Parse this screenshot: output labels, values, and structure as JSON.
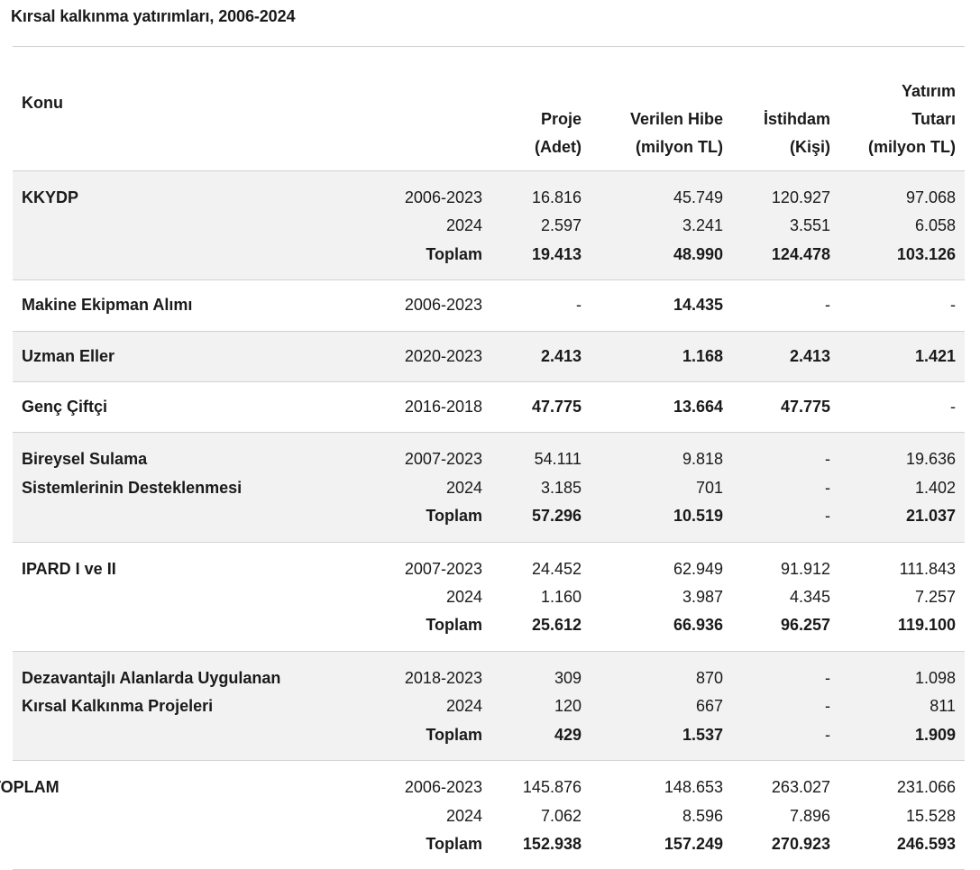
{
  "title": "Kırsal kalkınma yatırımları, 2006-2024",
  "headers": {
    "konu": "Konu",
    "proje_line1": "Proje",
    "proje_line2": "(Adet)",
    "hibe_line1": "Verilen Hibe",
    "hibe_line2": "(milyon TL)",
    "istihdam_line1": "İstihdam",
    "istihdam_line2": "(Kişi)",
    "yatirim_line1": "Yatırım",
    "yatirim_line2": "Tutarı",
    "yatirim_line3": "(milyon TL)"
  },
  "groups": [
    {
      "name_line1": "KKYDP",
      "rows": [
        [
          "2006-2023",
          "16.816",
          "45.749",
          "120.927",
          "97.068"
        ],
        [
          "2024",
          "2.597",
          "3.241",
          "3.551",
          "6.058"
        ],
        [
          "Toplam",
          "19.413",
          "48.990",
          "124.478",
          "103.126"
        ]
      ]
    },
    {
      "name_line1": "Makine Ekipman Alımı",
      "rows": [
        [
          "2006-2023",
          "-",
          "14.435",
          "-",
          "-"
        ]
      ]
    },
    {
      "name_line1": "Uzman Eller",
      "rows": [
        [
          "2020-2023",
          "2.413",
          "1.168",
          "2.413",
          "1.421"
        ]
      ]
    },
    {
      "name_line1": "Genç Çiftçi",
      "rows": [
        [
          "2016-2018",
          "47.775",
          "13.664",
          "47.775",
          "-"
        ]
      ]
    },
    {
      "name_line1": "Bireysel Sulama",
      "name_line2": "Sistemlerinin Desteklenmesi",
      "rows": [
        [
          "2007-2023",
          "54.111",
          "9.818",
          "-",
          "19.636"
        ],
        [
          "2024",
          "3.185",
          "701",
          "-",
          "1.402"
        ],
        [
          "Toplam",
          "57.296",
          "10.519",
          "-",
          "21.037"
        ]
      ]
    },
    {
      "name_line1": "IPARD I ve II",
      "rows": [
        [
          "2007-2023",
          "24.452",
          "62.949",
          "91.912",
          "111.843"
        ],
        [
          "2024",
          "1.160",
          "3.987",
          "4.345",
          "7.257"
        ],
        [
          "Toplam",
          "25.612",
          "66.936",
          "96.257",
          "119.100"
        ]
      ]
    },
    {
      "name_line1": "Dezavantajlı Alanlarda Uygulanan",
      "name_line2": "Kırsal Kalkınma Projeleri",
      "rows": [
        [
          "2018-2023",
          "309",
          "870",
          "-",
          "1.098"
        ],
        [
          "2024",
          "120",
          "667",
          "-",
          "811"
        ],
        [
          "Toplam",
          "429",
          "1.537",
          "-",
          "1.909"
        ]
      ]
    },
    {
      "name_line1": "TOPLAM",
      "rows": [
        [
          "2006-2023",
          "145.876",
          "148.653",
          "263.027",
          "231.066"
        ],
        [
          "2024",
          "7.062",
          "8.596",
          "7.896",
          "15.528"
        ],
        [
          "Toplam",
          "152.938",
          "157.249",
          "270.923",
          "246.593"
        ]
      ]
    }
  ]
}
